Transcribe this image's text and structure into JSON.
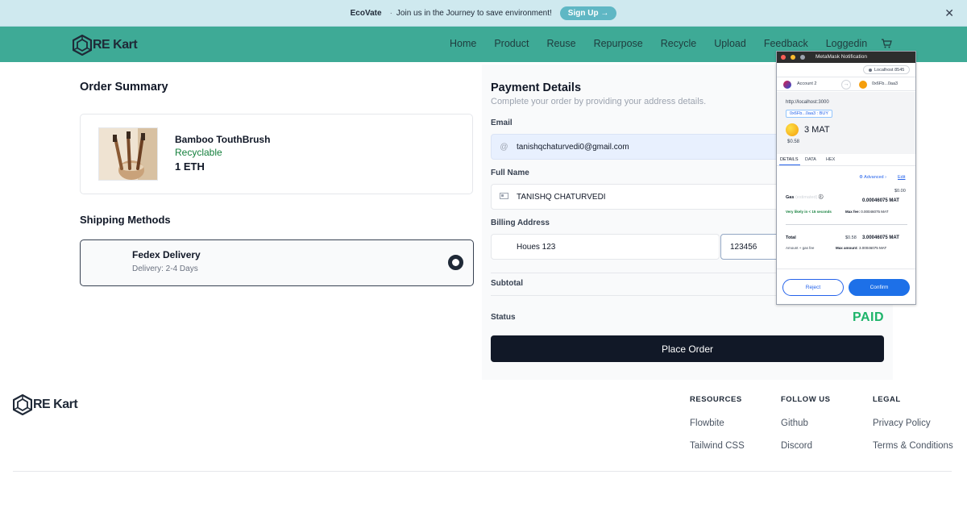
{
  "banner": {
    "brand": "EcoVate",
    "separator": "·",
    "message": "Join us in the Journey to save environment!",
    "signup": "Sign Up →",
    "close": "✕"
  },
  "nav": {
    "logo": "RE Kart",
    "items": [
      "Home",
      "Product",
      "Reuse",
      "Repurpose",
      "Recycle",
      "Upload",
      "Feedback",
      "Loggedin"
    ]
  },
  "order_summary": {
    "title": "Order Summary",
    "product": {
      "name": "Bamboo TouthBrush",
      "tag": "Recyclable",
      "price": "1 ETH"
    }
  },
  "shipping": {
    "title": "Shipping Methods",
    "method": "Fedex Delivery",
    "eta": "Delivery: 2-4 Days"
  },
  "payment": {
    "title": "Payment Details",
    "subtitle": "Complete your order by providing your address details.",
    "email_label": "Email",
    "email": "tanishqchaturvedi0@gmail.com",
    "name_label": "Full Name",
    "name": "TANISHQ CHATURVEDI",
    "billing_label": "Billing Address",
    "address": "Houes 123",
    "zip": "123456",
    "subtotal_label": "Subtotal",
    "status_label": "Status",
    "status": "PAID",
    "place_order": "Place Order"
  },
  "metamask": {
    "title": "MetaMask Notification",
    "network": "Localhost 8545",
    "account": "Account 2",
    "to": "0x6Fb...0aa3",
    "origin": "http://localhost:3000",
    "method": "0x6Fb...0aa3 : BUY",
    "amount": "3 MAT",
    "usd": "$0.58",
    "tabs": [
      "DETAILS",
      "DATA",
      "HEX"
    ],
    "advanced": "Advanced",
    "edit": "Edit",
    "gas_label": "Gas",
    "gas_est": "(estimated)",
    "gas_usd": "$0.00",
    "gas_mat": "0.00046075 MAT",
    "likely": "Very likely in < 15 seconds",
    "max_fee_label": "Max fee:",
    "max_fee": "0.00046075 MAT",
    "total_label": "Total",
    "total_usd": "$0.58",
    "total_mat": "3.00046075 MAT",
    "amount_gas": "Amount + gas fee",
    "max_amount_label": "Max amount:",
    "max_amount": "3.00046075 MAT",
    "reject": "Reject",
    "confirm": "Confirm"
  },
  "footer": {
    "logo": "RE Kart",
    "columns": [
      {
        "title": "RESOURCES",
        "links": [
          "Flowbite",
          "Tailwind CSS"
        ]
      },
      {
        "title": "FOLLOW US",
        "links": [
          "Github",
          "Discord"
        ]
      },
      {
        "title": "LEGAL",
        "links": [
          "Privacy Policy",
          "Terms & Conditions"
        ]
      }
    ]
  }
}
